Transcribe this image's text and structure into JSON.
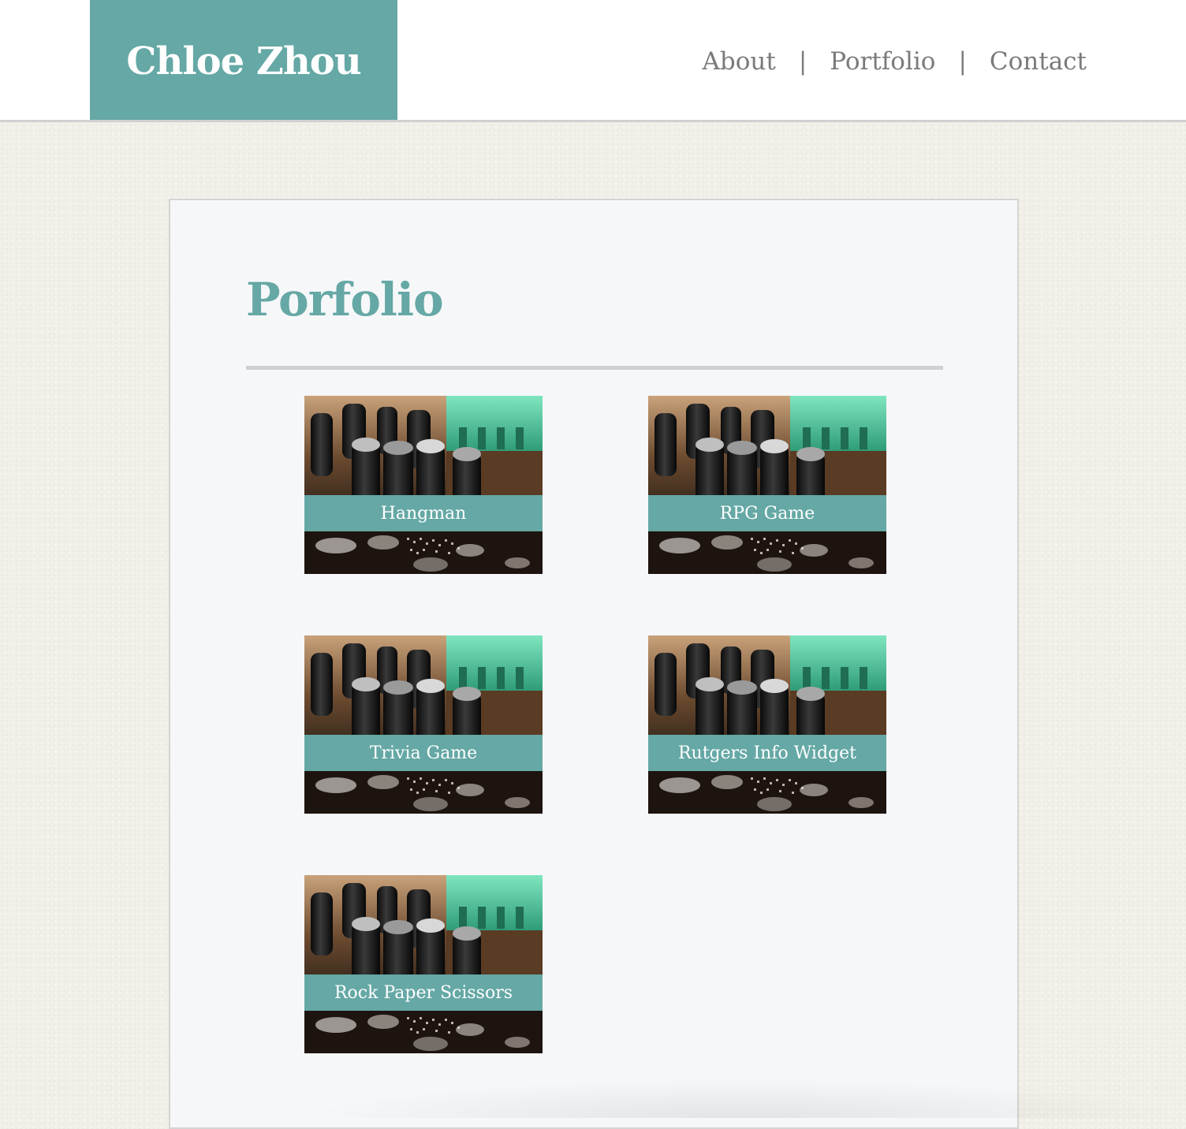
{
  "header": {
    "brand": "Chloe Zhou",
    "nav": {
      "about": "About",
      "portfolio": "Portfolio",
      "contact": "Contact",
      "separator": "|"
    }
  },
  "main": {
    "title": "Porfolio",
    "projects": [
      {
        "label": "Hangman"
      },
      {
        "label": "RPG Game"
      },
      {
        "label": "Trivia Game"
      },
      {
        "label": "Rutgers Info Widget"
      },
      {
        "label": "Rock Paper Scissors"
      }
    ]
  },
  "colors": {
    "accent": "#65a8a5",
    "nav_text": "#7a7a7a",
    "card_background": "#f6f7f9",
    "page_background": "#f2efe8"
  }
}
